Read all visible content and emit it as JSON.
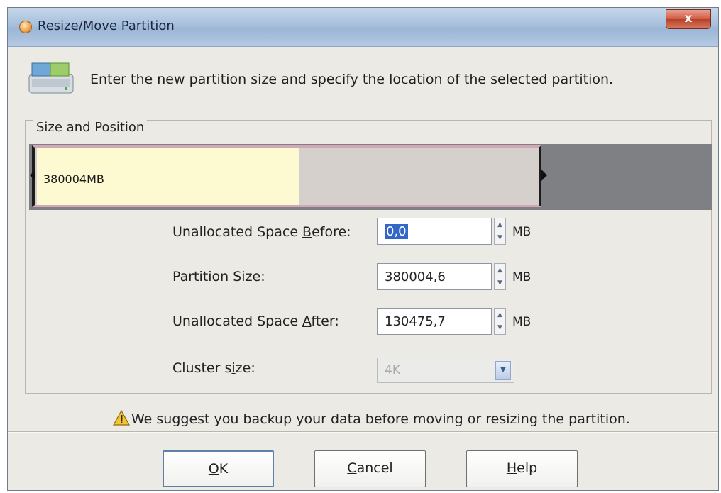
{
  "window": {
    "title": "Resize/Move Partition",
    "close_label": "x"
  },
  "header": {
    "text": "Enter the new partition size and specify the location of the selected partition."
  },
  "group": {
    "legend": "Size and Position"
  },
  "partition_bar": {
    "label": "380004MB",
    "used_fraction": 0.52
  },
  "fields": {
    "unallocated_before": {
      "label_pre": "Unallocated Space ",
      "label_key": "B",
      "label_post": "efore:",
      "value": "0,0",
      "unit": "MB"
    },
    "partition_size": {
      "label_pre": "Partition ",
      "label_key": "S",
      "label_post": "ize:",
      "value": "380004,6",
      "unit": "MB"
    },
    "unallocated_after": {
      "label_pre": "Unallocated Space ",
      "label_key": "A",
      "label_post": "fter:",
      "value": "130475,7",
      "unit": "MB"
    },
    "cluster_size": {
      "label_pre": "Cluster s",
      "label_key": "i",
      "label_post": "ze:",
      "value": "4K"
    }
  },
  "warning": {
    "text": "We suggest you backup your data before moving or resizing the partition."
  },
  "buttons": {
    "ok": {
      "key": "O",
      "rest": "K"
    },
    "cancel": {
      "key": "C",
      "rest": "ancel"
    },
    "help": {
      "key": "H",
      "rest": "elp"
    }
  },
  "icons": {
    "app": "partition-app-icon",
    "header": "disk-drive-icon",
    "warning": "warning-triangle-icon",
    "spin_up": "spin-up-arrow-icon",
    "spin_down": "spin-down-arrow-icon",
    "dropdown": "chevron-down-icon"
  }
}
